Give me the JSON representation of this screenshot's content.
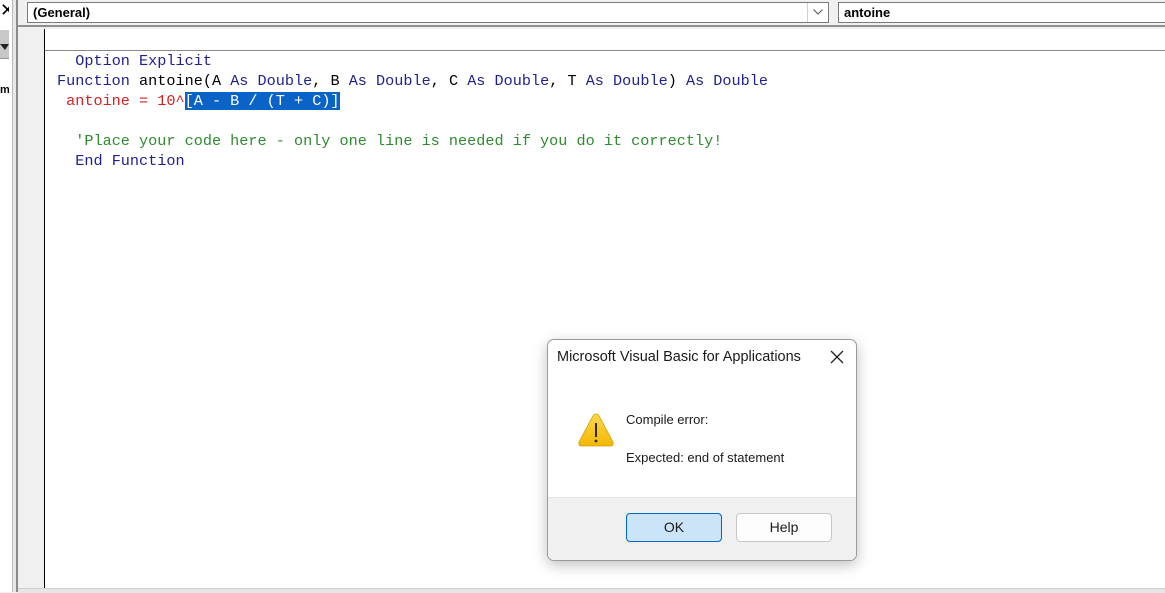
{
  "left_pane": {
    "close_glyph": "✕",
    "label_fragment": "m"
  },
  "combos": {
    "object": {
      "value": "(General)",
      "icon": "chevron-down-icon"
    },
    "procedure": {
      "value": "antoine"
    }
  },
  "code": {
    "line1": {
      "kw": "Option Explicit"
    },
    "line3": {
      "kw1": "Function",
      "text1": " antoine(A ",
      "kw2": "As Double",
      "text2": ", B ",
      "kw3": "As Double",
      "text3": ", C ",
      "kw4": "As Double",
      "text4": ", T ",
      "kw5": "As Double",
      "text5": ") ",
      "kw6": "As Double"
    },
    "line4": {
      "prefix": " antoine = 10^",
      "selected": "[A - B / (T + C)]"
    },
    "line5": {
      "comment": "'Place your code here - only one line is needed if you do it correctly!"
    },
    "line6": {
      "kw": "End Function"
    }
  },
  "dialog": {
    "title": "Microsoft Visual Basic for Applications",
    "close_icon": "close-icon",
    "icon": "warning-icon",
    "message_title": "Compile error:",
    "message_detail": "Expected: end of statement",
    "buttons": {
      "ok": "OK",
      "help": "Help"
    }
  }
}
